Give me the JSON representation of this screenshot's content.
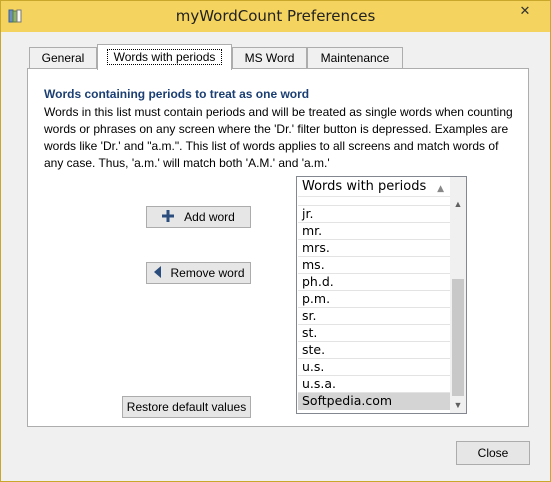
{
  "window": {
    "title": "myWordCount Preferences",
    "close_glyph": "✕",
    "icon": "book-icon",
    "accent_color": "#f4d35e"
  },
  "tabs": [
    {
      "label": "General"
    },
    {
      "label": "Words with periods",
      "active": true
    },
    {
      "label": "MS Word"
    },
    {
      "label": "Maintenance"
    }
  ],
  "panel": {
    "heading": "Words containing periods to treat as one word",
    "description": "Words in this list must contain periods and will be treated as single words when counting words or phrases on any screen where the 'Dr.' filter button is depressed. Examples are words like 'Dr.' and \"a.m.\". This list of words applies to all screens and match words of any case. Thus, 'a.m.' will match both 'A.M.' and 'a.m.'",
    "add_word_label": "Add word",
    "remove_word_label": "Remove word",
    "restore_label": "Restore default values"
  },
  "list": {
    "header": "Words with periods",
    "sort_glyph": "▲",
    "rows": [
      "jr.",
      "mr.",
      "mrs.",
      "ms.",
      "ph.d.",
      "p.m.",
      "sr.",
      "st.",
      "ste.",
      "u.s.",
      "u.s.a.",
      "Softpedia.com"
    ],
    "selected": "Softpedia.com",
    "scroll_up_glyph": "▲",
    "scroll_down_glyph": "▼"
  },
  "footer": {
    "close_label": "Close"
  }
}
